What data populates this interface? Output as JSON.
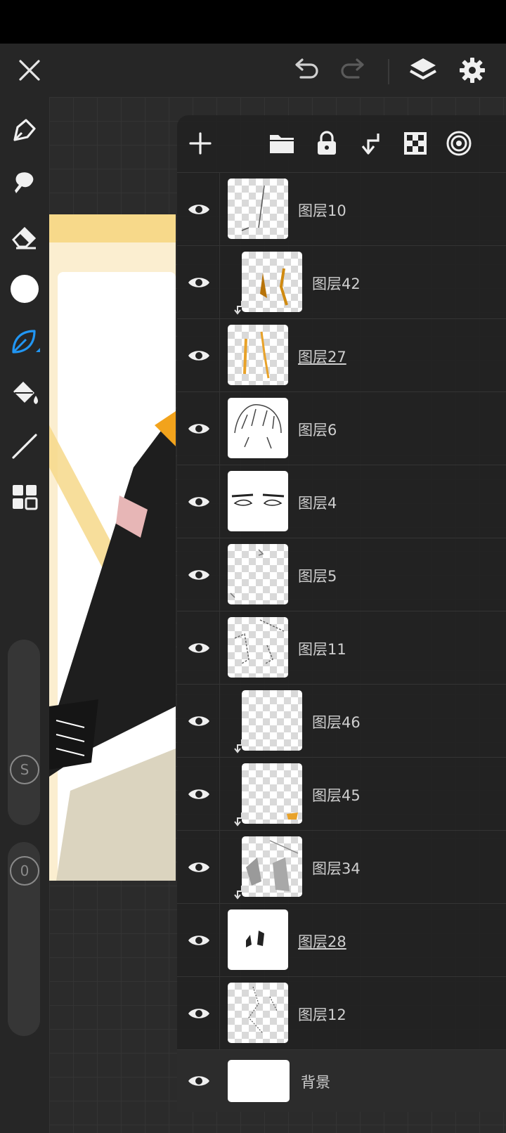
{
  "toolbar": {
    "close_icon": "close-icon",
    "undo_icon": "undo-icon",
    "redo_icon": "redo-icon",
    "layers_icon": "layers-icon",
    "settings_icon": "gear-icon"
  },
  "tools": [
    {
      "name": "pen-tool",
      "icon": "pen-icon"
    },
    {
      "name": "smudge-tool",
      "icon": "smudge-icon"
    },
    {
      "name": "eraser-tool",
      "icon": "eraser-icon"
    },
    {
      "name": "color-picker",
      "icon": "color-circle-icon",
      "color": "#ffffff"
    },
    {
      "name": "brush-tool",
      "icon": "leaf-brush-icon",
      "active": true,
      "color": "#2196f3"
    },
    {
      "name": "fill-tool",
      "icon": "paint-bucket-icon"
    },
    {
      "name": "line-tool",
      "icon": "line-icon"
    },
    {
      "name": "materials-tool",
      "icon": "grid-icon"
    }
  ],
  "sliders": {
    "size_label": "S",
    "opacity_label": "0"
  },
  "layer_panel": {
    "actions": [
      "add-icon",
      "folder-icon",
      "lock-icon",
      "clip-icon",
      "transparency-icon",
      "blend-icon"
    ],
    "layers": [
      {
        "name": "图层10",
        "clipped": false,
        "underlined": false
      },
      {
        "name": "图层42",
        "clipped": true,
        "underlined": false
      },
      {
        "name": "图层27",
        "clipped": false,
        "underlined": true
      },
      {
        "name": "图层6",
        "clipped": false,
        "underlined": false
      },
      {
        "name": "图层4",
        "clipped": false,
        "underlined": false
      },
      {
        "name": "图层5",
        "clipped": false,
        "underlined": false
      },
      {
        "name": "图层11",
        "clipped": false,
        "underlined": false
      },
      {
        "name": "图层46",
        "clipped": true,
        "underlined": false
      },
      {
        "name": "图层45",
        "clipped": true,
        "underlined": false
      },
      {
        "name": "图层34",
        "clipped": true,
        "underlined": false
      },
      {
        "name": "图层28",
        "clipped": false,
        "underlined": true
      },
      {
        "name": "图层12",
        "clipped": false,
        "underlined": false
      },
      {
        "name": "背景",
        "clipped": false,
        "underlined": false,
        "background": true
      }
    ]
  },
  "colors": {
    "accent": "#2196f3",
    "panel": "#222222",
    "text": "#cfcfcf"
  }
}
